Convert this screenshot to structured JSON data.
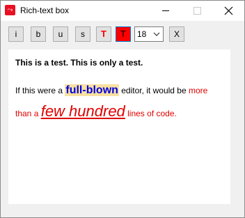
{
  "window": {
    "title": "Rich-text box",
    "icon": "app-icon"
  },
  "toolbar": {
    "italic_label": "i",
    "bold_label": "b",
    "underline_label": "u",
    "strike_label": "s",
    "text_color_label": "T",
    "back_color_label": "T",
    "size_value": "18",
    "clear_label": "X",
    "colors": {
      "text_color": "#ff0000",
      "back_color": "#ff0000"
    }
  },
  "editor": {
    "line1": "This is a test. This is only a test.",
    "p_start": "If this were a ",
    "p_hl": "full-blown",
    "p_mid": " editor, it would be ",
    "p_red1": "more than a ",
    "p_big": "few hundred",
    "p_red2": " lines of code.",
    "colors": {
      "highlight_bg": "#f8e0a0",
      "highlight_text": "#0000e0",
      "red_text": "#e00000"
    }
  }
}
